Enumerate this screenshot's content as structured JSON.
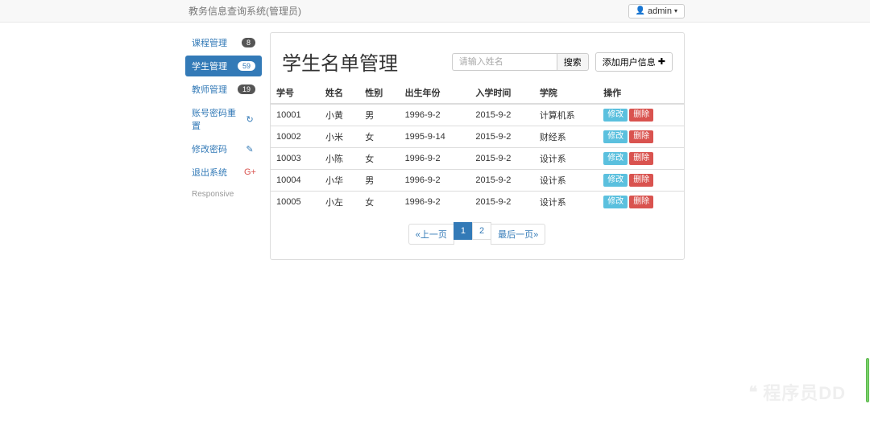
{
  "navbar": {
    "brand": "教务信息查询系统(管理员)",
    "user": "admin"
  },
  "sidebar": {
    "items": [
      {
        "label": "课程管理",
        "badge": "8"
      },
      {
        "label": "学生管理",
        "badge": "59"
      },
      {
        "label": "教师管理",
        "badge": "19"
      },
      {
        "label": "账号密码重置"
      },
      {
        "label": "修改密码"
      },
      {
        "label": "退出系统"
      }
    ],
    "footer": "Responsive"
  },
  "panel": {
    "title": "学生名单管理",
    "search_placeholder": "请输入姓名",
    "search_button": "搜索",
    "add_button": "添加用户信息"
  },
  "table": {
    "columns": [
      "学号",
      "姓名",
      "性别",
      "出生年份",
      "入学时间",
      "学院",
      "操作"
    ],
    "rows": [
      {
        "id": "10001",
        "name": "小黄",
        "gender": "男",
        "birth": "1996-9-2",
        "enroll": "2015-9-2",
        "college": "计算机系"
      },
      {
        "id": "10002",
        "name": "小米",
        "gender": "女",
        "birth": "1995-9-14",
        "enroll": "2015-9-2",
        "college": "财经系"
      },
      {
        "id": "10003",
        "name": "小陈",
        "gender": "女",
        "birth": "1996-9-2",
        "enroll": "2015-9-2",
        "college": "设计系"
      },
      {
        "id": "10004",
        "name": "小华",
        "gender": "男",
        "birth": "1996-9-2",
        "enroll": "2015-9-2",
        "college": "设计系"
      },
      {
        "id": "10005",
        "name": "小左",
        "gender": "女",
        "birth": "1996-9-2",
        "enroll": "2015-9-2",
        "college": "设计系"
      }
    ],
    "actions": {
      "edit": "修改",
      "delete": "删除"
    }
  },
  "pagination": {
    "prev": "«上一页",
    "pages": [
      "1",
      "2"
    ],
    "next": "最后一页»",
    "current": "1"
  },
  "watermark": "程序员DD"
}
